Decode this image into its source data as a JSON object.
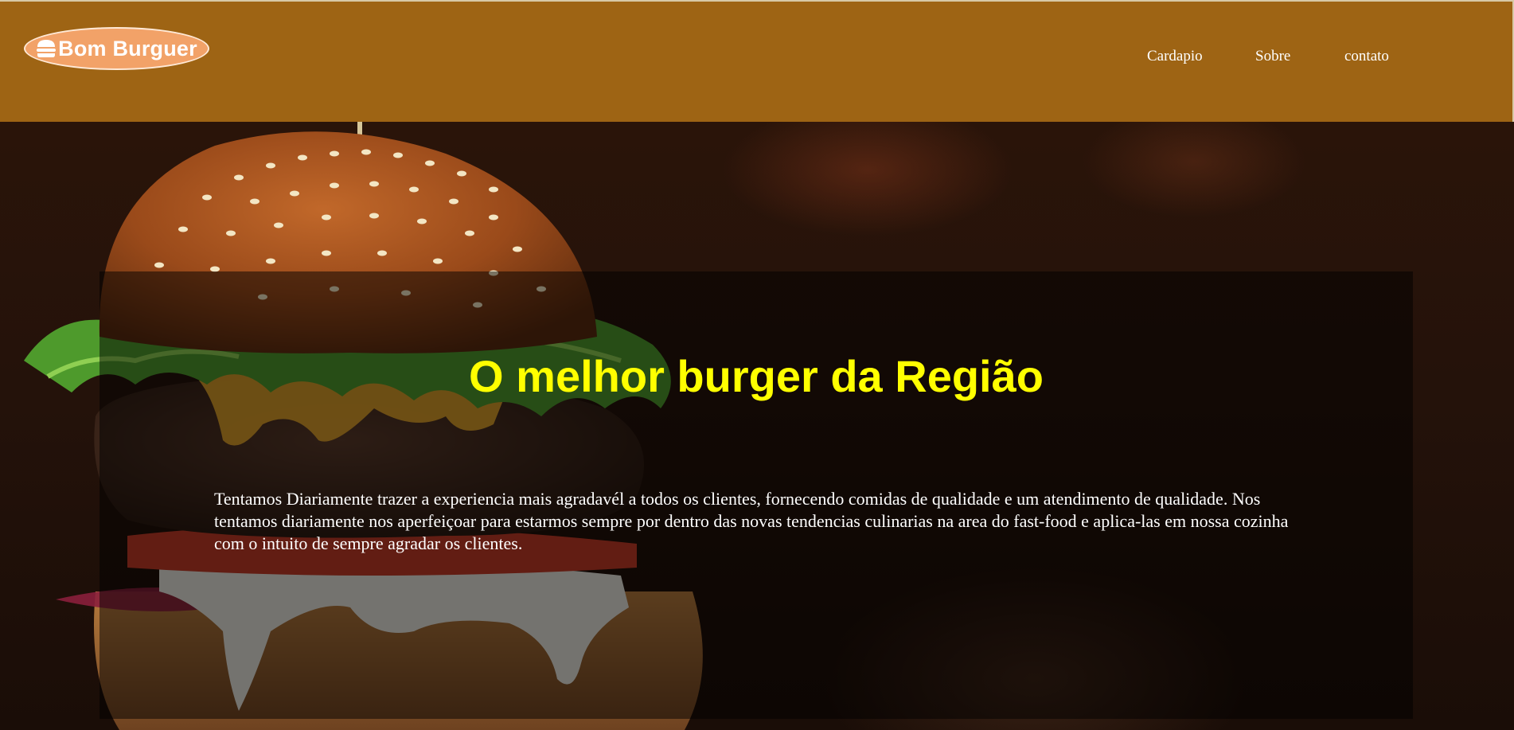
{
  "brand": {
    "name": "Bom Burguer",
    "icon": "burger-icon"
  },
  "nav": {
    "items": [
      "Cardapio",
      "Sobre",
      "contato"
    ]
  },
  "hero": {
    "title": "O melhor burger da Região",
    "text": "Tentamos Diariamente trazer a experiencia mais agradavél a todos os clientes, fornecendo comidas de qualidade e um atendimento de qualidade. Nos tentamos diariamente nos aperfeiçoar para estarmos sempre por dentro das novas tendencias culinarias na area do fast-food e aplica-las em nossa cozinha com o intuito de sempre agradar os clientes."
  },
  "colors": {
    "header": "#9e6414",
    "logo_bg": "#f2a268",
    "title": "#ffff00",
    "text": "#ffffff"
  }
}
